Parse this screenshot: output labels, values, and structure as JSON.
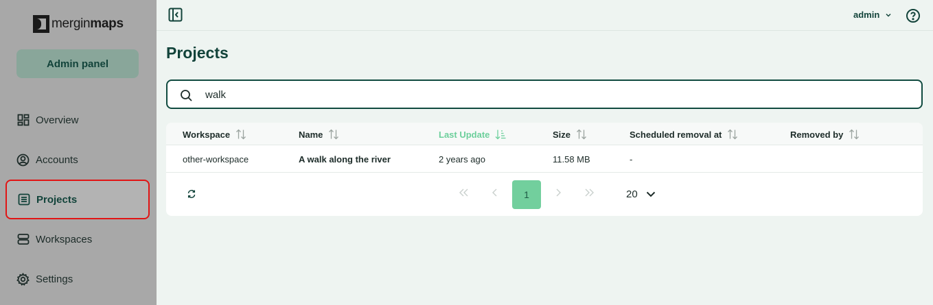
{
  "sidebar": {
    "logo": {
      "prefix": "mergin",
      "suffix": "maps"
    },
    "admin_panel": "Admin panel",
    "items": [
      {
        "label": "Overview",
        "icon": "dashboard-icon"
      },
      {
        "label": "Accounts",
        "icon": "user-circle-icon"
      },
      {
        "label": "Projects",
        "icon": "list-icon",
        "active": true
      },
      {
        "label": "Workspaces",
        "icon": "server-icon"
      },
      {
        "label": "Settings",
        "icon": "gear-icon"
      }
    ]
  },
  "topbar": {
    "user": "admin"
  },
  "page": {
    "title": "Projects"
  },
  "search": {
    "value": "walk",
    "placeholder": ""
  },
  "table": {
    "columns": [
      "Workspace",
      "Name",
      "Last Update",
      "Size",
      "Scheduled removal at",
      "Removed by"
    ],
    "sorted_column": "Last Update",
    "rows": [
      {
        "workspace": "other-workspace",
        "name": "A walk along the river",
        "last_update": "2 years ago",
        "size": "11.58 MB",
        "scheduled_removal": "-",
        "removed_by": ""
      }
    ]
  },
  "pagination": {
    "current_page": "1",
    "per_page": "20"
  },
  "colors": {
    "accent": "#12433a",
    "sorted": "#6ccf9b",
    "current_page_bg": "#72cf9d",
    "sidebar_bg": "#a8a8a8",
    "active_outline": "#e11414"
  }
}
